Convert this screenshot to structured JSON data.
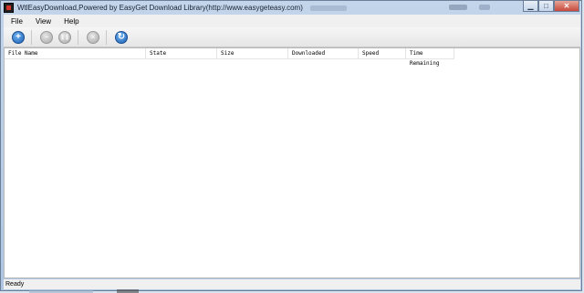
{
  "window": {
    "title": "WtlEasyDownload,Powered by EasyGet Download Library(http://www.easygeteasy.com)"
  },
  "menu": [
    {
      "label": "File"
    },
    {
      "label": "View"
    },
    {
      "label": "Help"
    }
  ],
  "toolbar": {
    "buttons": [
      {
        "icon": "add-icon",
        "glyph": "+",
        "enabled": true
      },
      {
        "icon": "minus-icon",
        "glyph": "−",
        "enabled": false
      },
      {
        "icon": "pause-icon",
        "glyph": "❚❚",
        "enabled": false
      },
      {
        "icon": "close-icon",
        "glyph": "×",
        "enabled": false
      },
      {
        "icon": "refresh-icon",
        "glyph": "↻",
        "enabled": true
      }
    ]
  },
  "list": {
    "columns": [
      {
        "label": "File Name"
      },
      {
        "label": "State"
      },
      {
        "label": "Size"
      },
      {
        "label": "Downloaded"
      },
      {
        "label": "Speed"
      },
      {
        "label": "Time Remaining"
      }
    ],
    "rows": []
  },
  "status": {
    "text": "Ready"
  },
  "colors": {
    "accent": "#1c5fb4",
    "close_button": "#c6493a"
  }
}
